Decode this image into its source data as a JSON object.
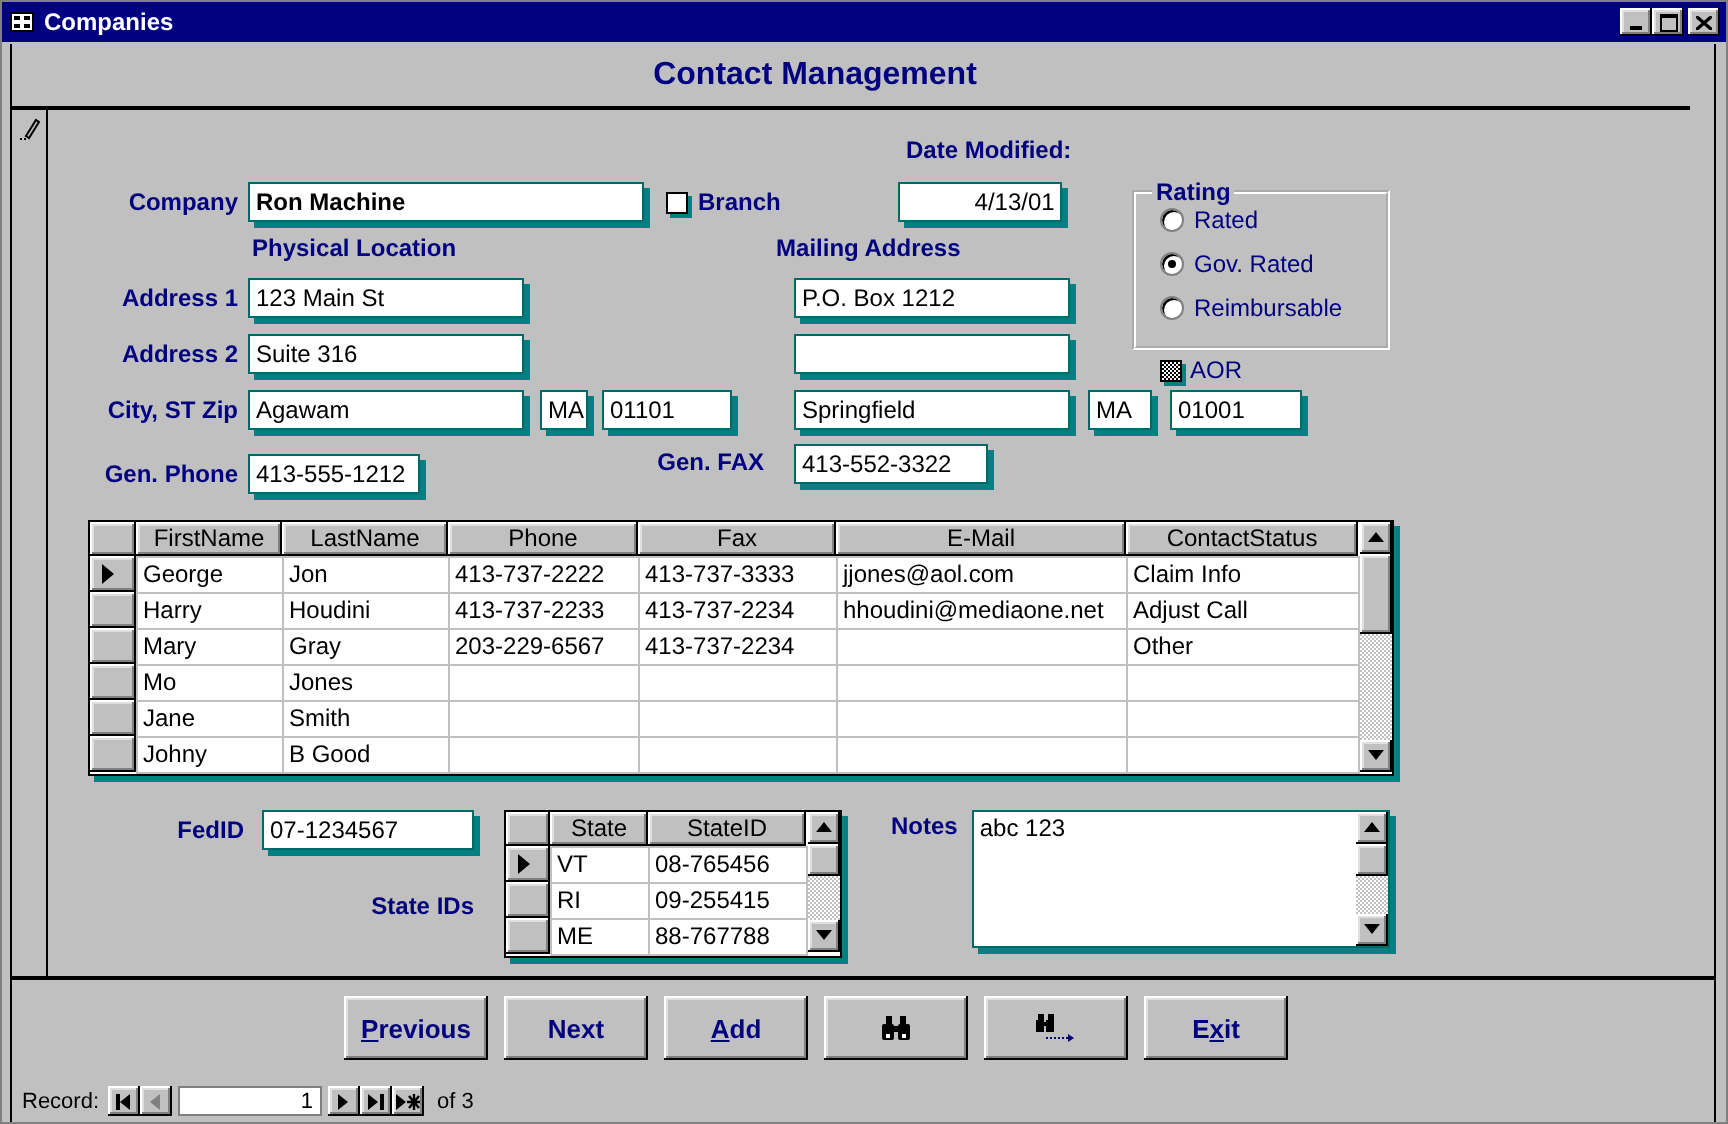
{
  "window": {
    "title": "Companies"
  },
  "form_title": "Contact Management",
  "company": {
    "label": "Company",
    "value": "Ron Machine"
  },
  "branch": {
    "label": "Branch",
    "checked": false
  },
  "date_modified": {
    "label": "Date Modified:",
    "value": "4/13/01"
  },
  "rating": {
    "label": "Rating",
    "options": [
      {
        "label": "Rated",
        "selected": false
      },
      {
        "label": "Gov. Rated",
        "selected": true
      },
      {
        "label": "Reimbursable",
        "selected": false
      }
    ]
  },
  "aor": {
    "label": "AOR",
    "indeterminate": true
  },
  "physical_heading": "Physical Location",
  "mailing_heading": "Mailing Address",
  "address1": {
    "label": "Address 1",
    "physical": "123 Main St",
    "mailing": "P.O. Box 1212"
  },
  "address2": {
    "label": "Address 2",
    "physical": "Suite 316"
  },
  "city_st_zip": {
    "label": "City, ST Zip",
    "physical": {
      "city": "Agawam",
      "state": "MA",
      "zip": "01101"
    },
    "mailing": {
      "city": "Springfield",
      "state": "MA",
      "zip": "01001"
    }
  },
  "phone": {
    "label": "Gen. Phone",
    "value": "413-555-1212"
  },
  "fax": {
    "label": "Gen. FAX",
    "value": "413-552-3322"
  },
  "contacts": {
    "columns": [
      "FirstName",
      "LastName",
      "Phone",
      "Fax",
      "E-Mail",
      "ContactStatus"
    ],
    "rows": [
      {
        "current": true,
        "cells": [
          "George",
          "Jon",
          "413-737-2222",
          "413-737-3333",
          "jjones@aol.com",
          "Claim Info"
        ]
      },
      {
        "current": false,
        "cells": [
          "Harry",
          "Houdini",
          "413-737-2233",
          "413-737-2234",
          "hhoudini@mediaone.net",
          "Adjust Call"
        ]
      },
      {
        "current": false,
        "cells": [
          "Mary",
          "Gray",
          "203-229-6567",
          "413-737-2234",
          null,
          "Other"
        ]
      },
      {
        "current": false,
        "cells": [
          "Mo",
          "Jones",
          null,
          null,
          null,
          null
        ]
      },
      {
        "current": false,
        "cells": [
          "Jane",
          "Smith",
          null,
          null,
          null,
          null
        ]
      },
      {
        "current": false,
        "cells": [
          "Johny",
          "B Good",
          null,
          null,
          null,
          null
        ]
      }
    ]
  },
  "fed_id": {
    "label": "FedID",
    "value": "07-1234567"
  },
  "state_ids": {
    "label": "State IDs",
    "columns": [
      "State",
      "StateID"
    ],
    "rows": [
      {
        "current": true,
        "cells": [
          "VT",
          "08-765456"
        ]
      },
      {
        "current": false,
        "cells": [
          "RI",
          "09-255415"
        ]
      },
      {
        "current": false,
        "cells": [
          "ME",
          "88-767788"
        ]
      }
    ]
  },
  "notes": {
    "label": "Notes",
    "value": "abc 123"
  },
  "buttons": [
    {
      "kind": "text",
      "key": "P",
      "rest": "revious"
    },
    {
      "kind": "text",
      "rest": "Next"
    },
    {
      "kind": "text",
      "key": "A",
      "rest": "dd"
    },
    {
      "kind": "find"
    },
    {
      "kind": "find-next"
    },
    {
      "kind": "text",
      "lead": "E",
      "key": "x",
      "rest": "it"
    }
  ],
  "record_nav": {
    "label": "Record:",
    "current": "1",
    "total": "of 3"
  }
}
